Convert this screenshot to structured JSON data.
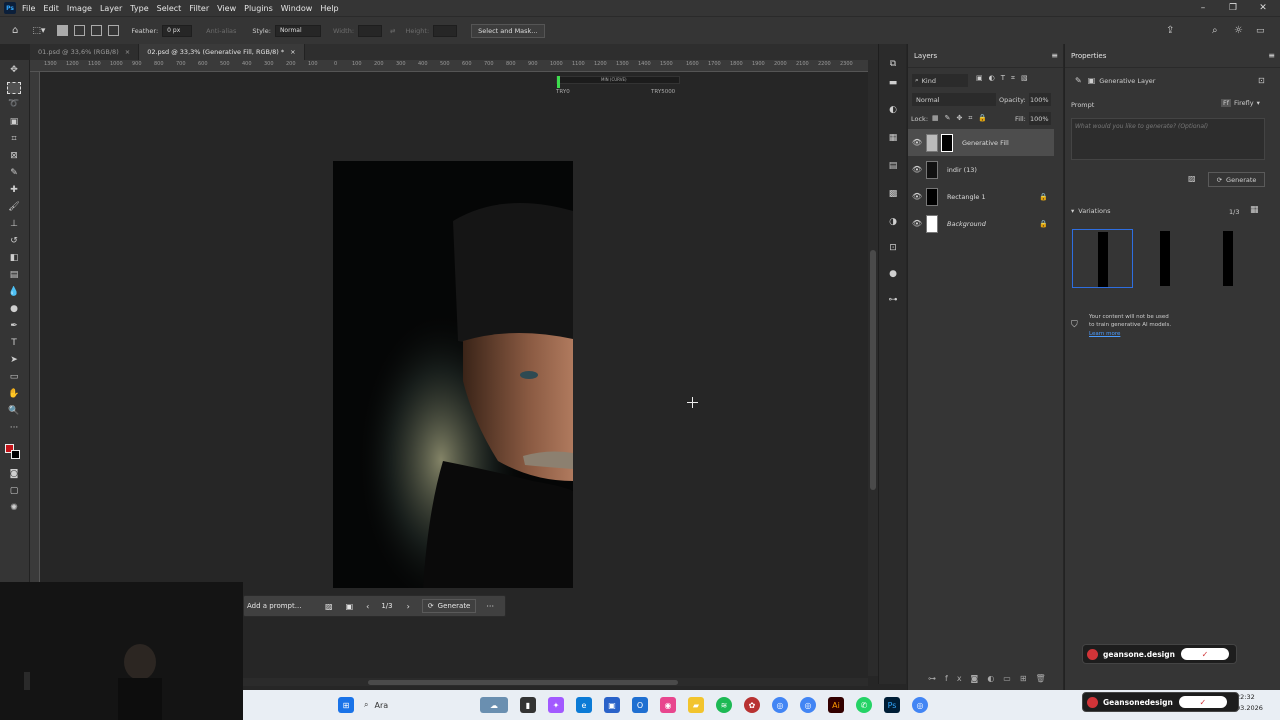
{
  "app": {
    "logo": "Ps"
  },
  "menu": [
    "File",
    "Edit",
    "Image",
    "Layer",
    "Type",
    "Select",
    "Filter",
    "View",
    "Plugins",
    "Window",
    "Help"
  ],
  "options": {
    "feather_label": "Feather:",
    "feather_value": "0 px",
    "antialias": "Anti-alias",
    "style_label": "Style:",
    "style_value": "Normal",
    "width_label": "Width:",
    "height_label": "Height:",
    "select_mask": "Select and Mask..."
  },
  "tabs": [
    {
      "label": "01.psd @ 33,6% (RGB/8)"
    },
    {
      "label": "02.psd @ 33,3% (Generative Fill, RGB/8) *"
    }
  ],
  "ruler": [
    "1300",
    "1200",
    "1100",
    "1000",
    "900",
    "800",
    "700",
    "600",
    "500",
    "400",
    "300",
    "200",
    "100",
    "0",
    "100",
    "200",
    "300",
    "400",
    "500",
    "600",
    "700",
    "800",
    "900",
    "1000",
    "1100",
    "1200",
    "1300",
    "1400",
    "1500",
    "1600",
    "1700",
    "1800",
    "1900",
    "2000",
    "2100",
    "2200",
    "2300"
  ],
  "canvas_overlay": {
    "left_label": "TRY0",
    "right_label": "TRY5000",
    "center_text": "MIN (CURVE)"
  },
  "context_bar": {
    "prompt": "Add a prompt...",
    "counter": "1/3",
    "generate": "Generate"
  },
  "layers": {
    "title": "Layers",
    "kind": "Kind",
    "blend": "Normal",
    "opacity_label": "Opacity:",
    "opacity": "100%",
    "lock_label": "Lock:",
    "fill_label": "Fill:",
    "fill": "100%",
    "items": [
      {
        "name": "Generative Fill",
        "selected": true,
        "locked": false
      },
      {
        "name": "indir (13)",
        "selected": false,
        "locked": false
      },
      {
        "name": "Rectangle 1",
        "selected": false,
        "locked": true
      },
      {
        "name": "Background",
        "selected": false,
        "locked": true
      }
    ]
  },
  "properties": {
    "title": "Properties",
    "layer_type": "Generative Layer",
    "prompt_label": "Prompt",
    "model": "Firefly",
    "placeholder": "What would you like to generate? (Optional)",
    "generate": "Generate",
    "variations_label": "Variations",
    "variations_count": "1/3",
    "notice_line1": "Your content will not be used",
    "notice_line2": "to train generative AI models.",
    "learn_more": "Learn more"
  },
  "taskbar": {
    "search": "Ara",
    "time": "22:32",
    "date": "03.2026"
  },
  "watermarks": {
    "top": "geansone.design",
    "bottom": "Geansonedesign"
  }
}
